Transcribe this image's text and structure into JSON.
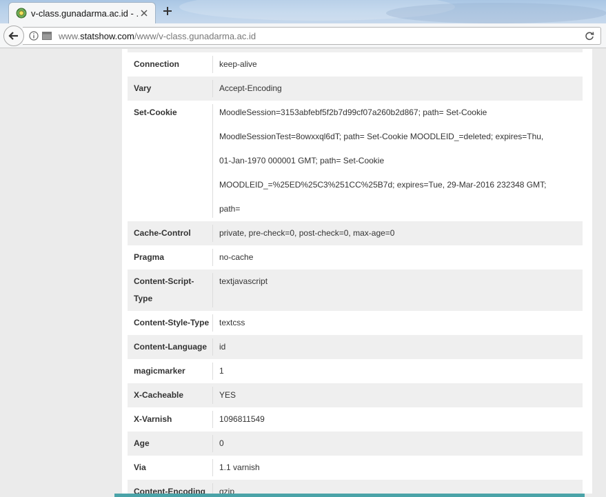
{
  "browser": {
    "tab_title": "v-class.gunadarma.ac.id - ...",
    "url_prefix": "www.",
    "url_host": "statshow.com",
    "url_path": "/www/v-class.gunadarma.ac.id"
  },
  "headers": [
    {
      "key": "Connection",
      "lines": [
        "keep-alive"
      ]
    },
    {
      "key": "Vary",
      "lines": [
        "Accept-Encoding"
      ]
    },
    {
      "key": "Set-Cookie",
      "lines": [
        "MoodleSession=3153abfebf5f2b7d99cf07a260b2d867; path= Set-Cookie",
        "MoodleSessionTest=8owxxql6dT; path= Set-Cookie MOODLEID_=deleted; expires=Thu,",
        "01-Jan-1970 000001 GMT; path= Set-Cookie",
        "MOODLEID_=%25ED%25C3%251CC%25B7d; expires=Tue, 29-Mar-2016 232348 GMT;",
        "path="
      ]
    },
    {
      "key": "Cache-Control",
      "lines": [
        "private, pre-check=0, post-check=0, max-age=0"
      ]
    },
    {
      "key": "Pragma",
      "lines": [
        "no-cache"
      ]
    },
    {
      "key": "Content-Script-Type",
      "lines": [
        "textjavascript"
      ]
    },
    {
      "key": "Content-Style-Type",
      "lines": [
        "textcss"
      ]
    },
    {
      "key": "Content-Language",
      "lines": [
        "id"
      ]
    },
    {
      "key": "magicmarker",
      "lines": [
        "1"
      ]
    },
    {
      "key": "X-Cacheable",
      "lines": [
        "YES"
      ]
    },
    {
      "key": "X-Varnish",
      "lines": [
        "1096811549"
      ]
    },
    {
      "key": "Age",
      "lines": [
        "0"
      ]
    },
    {
      "key": "Via",
      "lines": [
        "1.1 varnish"
      ]
    },
    {
      "key": "Content-Encoding",
      "lines": [
        "gzip"
      ]
    }
  ],
  "colors": {
    "row_alt": "#efefef",
    "footer_bar": "#4aa3a8"
  }
}
